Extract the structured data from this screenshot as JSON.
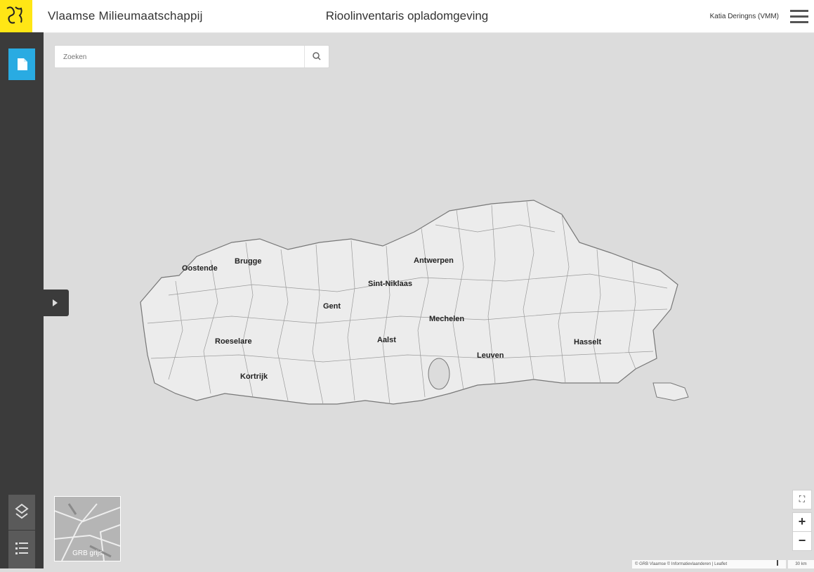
{
  "header": {
    "organization": "Vlaamse Milieumaatschappij",
    "title": "Rioolinventaris opladomgeving",
    "user": "Katia Deringns (VMM)"
  },
  "search": {
    "placeholder": "Zoeken"
  },
  "map": {
    "cities": [
      "Oostende",
      "Brugge",
      "Antwerpen",
      "Sint-Niklaas",
      "Gent",
      "Mechelen",
      "Roeselare",
      "Aalst",
      "Hasselt",
      "Leuven",
      "Kortrijk"
    ],
    "basemap_label": "GRB grijs",
    "zoom_in": "+",
    "zoom_out": "−",
    "fullscreen": "⛶",
    "attribution": "© GRB Vlaamse © Informatievlaanderen | Leaflet",
    "scale": "30 km"
  },
  "colors": {
    "accent": "#29abe2",
    "logo": "#ffe615",
    "sidebar": "#3b3b3b",
    "map_bg": "#dcdcdc"
  },
  "icons": [
    "document-icon",
    "search-icon",
    "expand-icon",
    "layers-icon",
    "legend-icon",
    "hamburger-icon",
    "logo-icon"
  ]
}
